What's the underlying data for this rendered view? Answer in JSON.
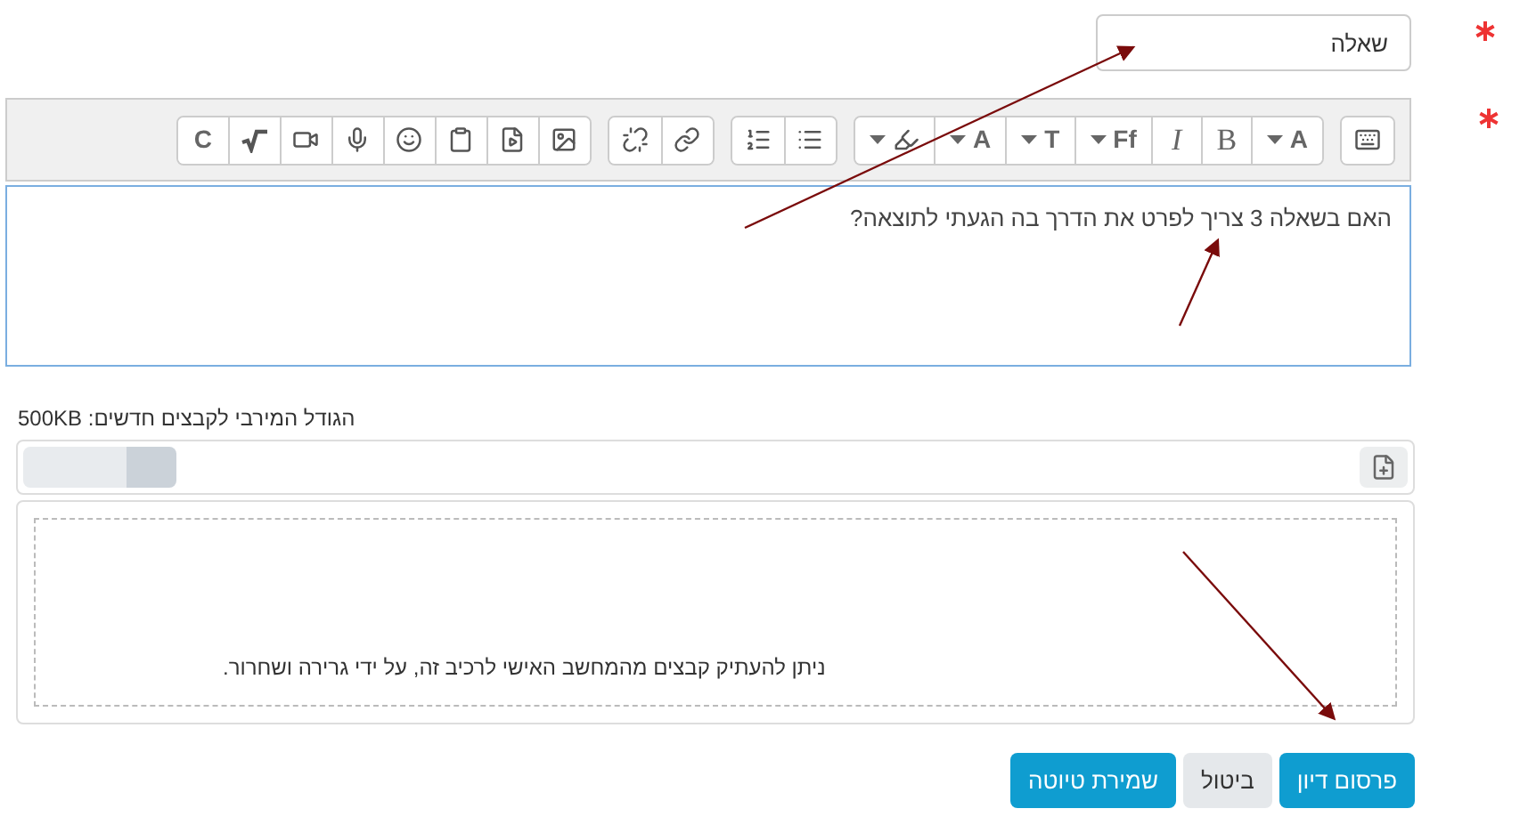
{
  "subject": {
    "value": "שאלה",
    "required": true
  },
  "editor": {
    "required": true,
    "toolbar": [
      [
        {
          "kind": "icon"
        }
      ],
      [
        {
          "kind": "dropdown",
          "glyph": "A"
        },
        {
          "kind": "glyph",
          "glyph": "B"
        },
        {
          "kind": "glyph",
          "glyph": "I"
        },
        {
          "kind": "dropdown",
          "glyph": "Ff"
        },
        {
          "kind": "dropdown",
          "glyph": "T"
        },
        {
          "kind": "dropdown",
          "glyph": "A"
        },
        {
          "kind": "dropdown"
        }
      ],
      [
        {
          "kind": "icon"
        },
        {
          "kind": "icon"
        }
      ],
      [
        {
          "kind": "icon"
        },
        {
          "kind": "icon"
        }
      ],
      [
        {
          "kind": "icon"
        },
        {
          "kind": "icon"
        },
        {
          "kind": "icon"
        },
        {
          "kind": "icon"
        },
        {
          "kind": "icon"
        },
        {
          "kind": "icon"
        },
        {
          "kind": "icon"
        },
        {
          "kind": "glyph",
          "glyph": "C"
        }
      ]
    ],
    "text": "האם בשאלה 3 צריך לפרט את הדרך בה הגעתי לתוצאה?"
  },
  "max_size": "הגודל המירבי לקבצים חדשים: 500KB",
  "dropzone": {
    "text": "ניתן להעתיק קבצים מהמחשב האישי לרכיב זה, על ידי גרירה ושחרור."
  },
  "buttons": [
    {
      "label": "פרסום דיון",
      "kind": "primary"
    },
    {
      "label": "ביטול",
      "kind": "secondary"
    },
    {
      "label": "שמירת טיוטה",
      "kind": "primary"
    }
  ]
}
